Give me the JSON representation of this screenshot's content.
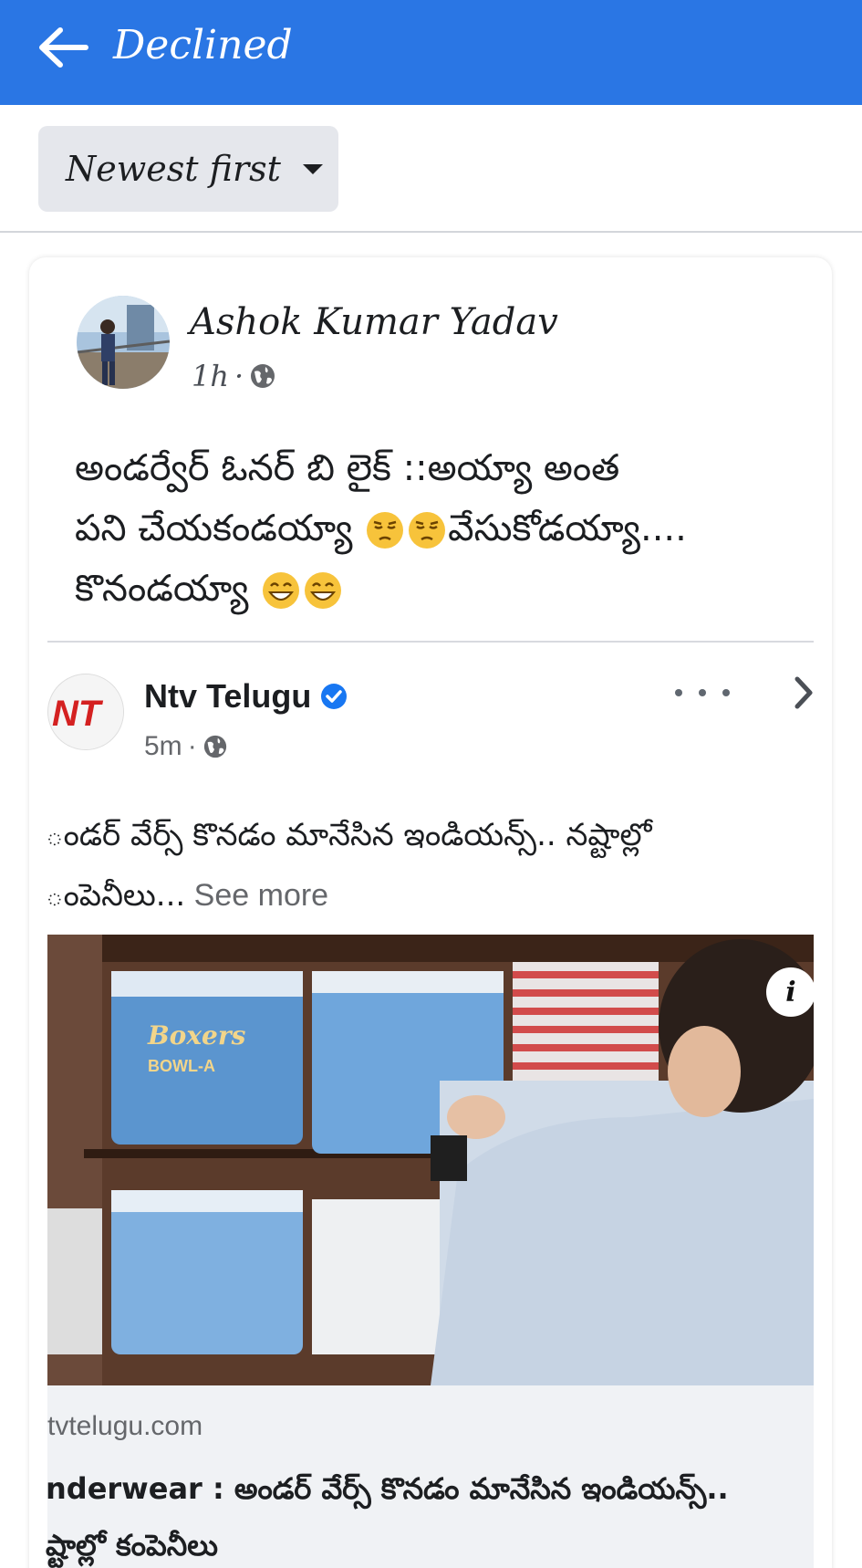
{
  "header": {
    "title": "Declined",
    "back_icon": "arrow-left-icon",
    "background_color": "#2a76e4"
  },
  "sort": {
    "label": "Newest first",
    "icon": "caret-down-icon"
  },
  "post": {
    "author": "Ashok Kumar Yadav",
    "time": "1h",
    "separator": "·",
    "privacy_icon": "globe-icon",
    "text_parts": {
      "line1": "అండర్వేర్ ఓనర్ బి లైక్ ::అయ్యా అంత",
      "line2a": "పని చేయకండయ్యా ",
      "line2b": "వేసుకోడయ్యా....",
      "line3": "కొనండయ్యా "
    },
    "emojis": [
      "pensive-face-icon",
      "pensive-face-icon",
      "grinning-face-icon",
      "grinning-face-icon"
    ]
  },
  "shared": {
    "page_name": "Ntv Telugu",
    "logo_text": "NT",
    "verified_icon": "verified-badge-icon",
    "time": "5m",
    "separator": "·",
    "privacy_icon": "globe-icon",
    "more_icon": "more-horizontal-icon",
    "next_icon": "chevron-right-icon",
    "text_line1": "ండర్ వేర్స్ కొనడం మానేసిన ఇండియన్స్.. నష్టాల్లో",
    "text_line2": "ంపెనీలు...",
    "see_more": " See more",
    "image_info_icon": "info-icon",
    "image_info_label": "i",
    "image_brand_text": "Boxers",
    "image_brand_sub": "BOWL-A"
  },
  "link": {
    "domain": "tvtelugu.com",
    "title_line1": "nderwear : అండర్ వేర్స్ కొనడం మానేసిన ఇండియన్స్..",
    "title_line2": "ష్టాల్లో కంపెనీలు"
  }
}
